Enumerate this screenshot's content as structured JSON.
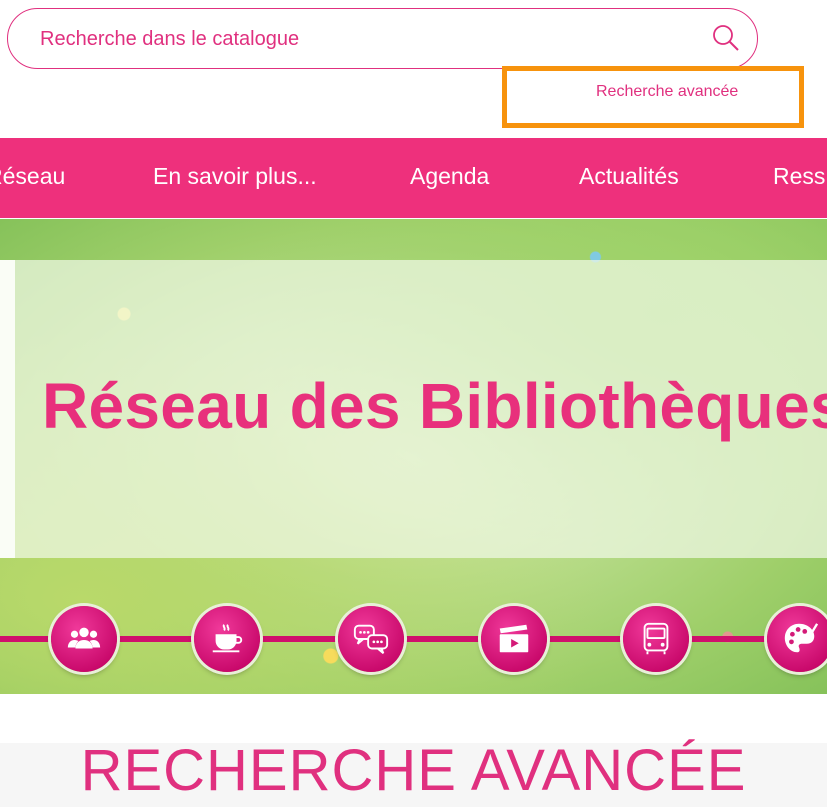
{
  "search": {
    "placeholder": "Recherche dans le catalogue",
    "advanced_link": "Recherche avancée"
  },
  "nav": {
    "items": [
      "Réseau",
      "En savoir plus...",
      "Agenda",
      "Actualités",
      "Ress"
    ]
  },
  "banner": {
    "title": "Réseau des Bibliothèques"
  },
  "icons": [
    "people-icon",
    "coffee-cup-icon",
    "chat-bubbles-icon",
    "clapperboard-icon",
    "bus-icon",
    "palette-icon"
  ],
  "section": {
    "title": "RECHERCHE AVANCÉE"
  },
  "colors": {
    "accent": "#ee307c",
    "highlight_border": "#f7930d"
  }
}
